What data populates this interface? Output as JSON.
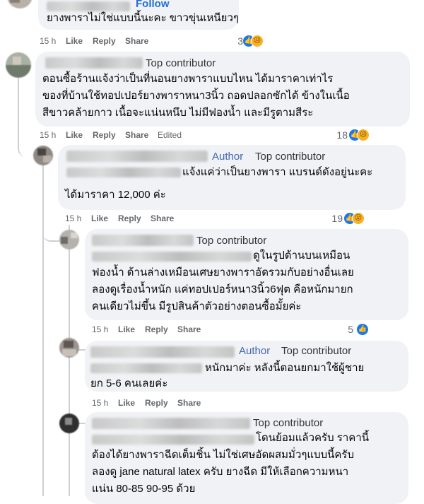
{
  "c1": {
    "follow": "Follow",
    "text": [
      "ยางพาราไม่ใช่แบบนี้นะคะ ขาวขุ่นเหนียวๆ"
    ],
    "time": "15 h",
    "like": "Like",
    "reply": "Reply",
    "share": "Share",
    "reactions": "3"
  },
  "c2": {
    "badge": "Top contributor",
    "text": [
      "ตอนซื้อร้านแจ้งว่าเป็นที่นอนยางพาราแบบไหน ได้มาราคาเท่าไร",
      "ของที่บ้านใช้ทอปเปอร์ยางพาราหนา3นิ้ว ถอดปลอกซักได้ ข้างในเนื้อ",
      "สีขาวคล้ายกาว เนื้อจะแน่นหนึบ ไม่มีฟองน้ำ และมีรูตามสีระ"
    ],
    "time": "15 h",
    "like": "Like",
    "reply": "Reply",
    "share": "Share",
    "edited": "Edited",
    "reactions": "18"
  },
  "c3": {
    "author": "Author",
    "badge": "Top contributor",
    "text": [
      "แจ้งแค่ว่าเป็นยางพารา แบรนด์ดังอยู่นะคะ",
      "ได้มาราคา 12,000 ค่ะ"
    ],
    "time": "15 h",
    "like": "Like",
    "reply": "Reply",
    "share": "Share",
    "reactions": "19"
  },
  "c4": {
    "badge": "Top contributor",
    "text": [
      "ดูในรูปด้านบนเหมือน",
      "ฟองน้ำ ด้านล่างเหมือนเศษยางพาราอัดรวมกับอย่างอื่นเลย",
      "ลองดูเรื่องน้ำหนัก แค่ทอปเปอร์หนา3นิ้ว6ฟุต คือหนักมายก",
      "คนเดียวไม่ขึ้น มีรูปสินค้าตัวอย่างตอนซื้อมั้ยค่ะ"
    ],
    "time": "15 h",
    "like": "Like",
    "reply": "Reply",
    "share": "Share",
    "reactions": "5"
  },
  "c5": {
    "author": "Author",
    "badge": "Top contributor",
    "text": [
      "หนักมาค่ะ หลังนี้ตอนยกมาใช้ผู้ชาย",
      "ยก 5-6 คนเลยค่ะ"
    ],
    "time": "15 h",
    "like": "Like",
    "reply": "Reply",
    "share": "Share"
  },
  "c6": {
    "badge": "Top contributor",
    "text": [
      "โดนย้อมแล้วครับ ราคานี้",
      "ต้องได้ยางพาราฉีดเต็มชิ้น ไม่ใช่เศษอัดผสมมั่วๆแบบนี้ครับ",
      "ลองดู jane natural latex ครับ ยางฉีด มีให้เลือกความหนา",
      "แน่น 80-85 90-95 ด้วย"
    ]
  },
  "icons": {
    "like": "like-icon",
    "sad": "sad-icon",
    "wow": "wow-icon"
  },
  "colors": {
    "bubble": "#f0f2f5",
    "link": "#216fdb",
    "author": "#4267b2",
    "meta": "#65676b"
  }
}
